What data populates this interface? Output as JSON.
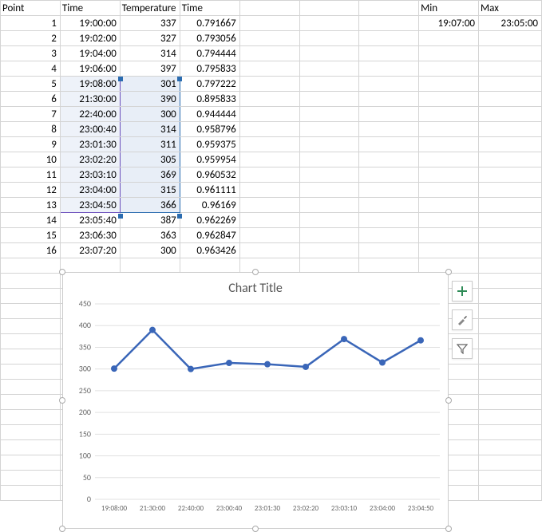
{
  "headers": {
    "point": "Point",
    "time": "Time",
    "temperature": "Temperature",
    "time2": "Time",
    "min": "Min",
    "max": "Max"
  },
  "minmax": {
    "min": "19:07:00",
    "max": "23:05:00"
  },
  "rows": [
    {
      "point": "1",
      "time": "19:00:00",
      "temp": "337",
      "time2": "0.791667"
    },
    {
      "point": "2",
      "time": "19:02:00",
      "temp": "327",
      "time2": "0.793056"
    },
    {
      "point": "3",
      "time": "19:04:00",
      "temp": "314",
      "time2": "0.794444"
    },
    {
      "point": "4",
      "time": "19:06:00",
      "temp": "397",
      "time2": "0.795833"
    },
    {
      "point": "5",
      "time": "19:08:00",
      "temp": "301",
      "time2": "0.797222"
    },
    {
      "point": "6",
      "time": "21:30:00",
      "temp": "390",
      "time2": "0.895833"
    },
    {
      "point": "7",
      "time": "22:40:00",
      "temp": "300",
      "time2": "0.944444"
    },
    {
      "point": "8",
      "time": "23:00:40",
      "temp": "314",
      "time2": "0.958796"
    },
    {
      "point": "9",
      "time": "23:01:30",
      "temp": "311",
      "time2": "0.959375"
    },
    {
      "point": "10",
      "time": "23:02:20",
      "temp": "305",
      "time2": "0.959954"
    },
    {
      "point": "11",
      "time": "23:03:10",
      "temp": "369",
      "time2": "0.960532"
    },
    {
      "point": "12",
      "time": "23:04:00",
      "temp": "315",
      "time2": "0.961111"
    },
    {
      "point": "13",
      "time": "23:04:50",
      "temp": "366",
      "time2": "0.96169"
    },
    {
      "point": "14",
      "time": "23:05:40",
      "temp": "387",
      "time2": "0.962269"
    },
    {
      "point": "15",
      "time": "23:06:30",
      "temp": "363",
      "time2": "0.962847"
    },
    {
      "point": "16",
      "time": "23:07:20",
      "temp": "300",
      "time2": "0.963426"
    }
  ],
  "chart_data": {
    "type": "line",
    "title": "Chart Title",
    "xlabel": "",
    "ylabel": "",
    "ylim": [
      0,
      450
    ],
    "yticks": [
      0,
      50,
      100,
      150,
      200,
      250,
      300,
      350,
      400,
      450
    ],
    "categories": [
      "19:08:00",
      "21:30:00",
      "22:40:00",
      "23:00:40",
      "23:01:30",
      "23:02:20",
      "23:03:10",
      "23:04:00",
      "23:04:50"
    ],
    "values": [
      301,
      390,
      300,
      314,
      311,
      305,
      369,
      315,
      366
    ]
  },
  "icons": {
    "plus": "+",
    "brush": "brush",
    "funnel": "funnel"
  }
}
